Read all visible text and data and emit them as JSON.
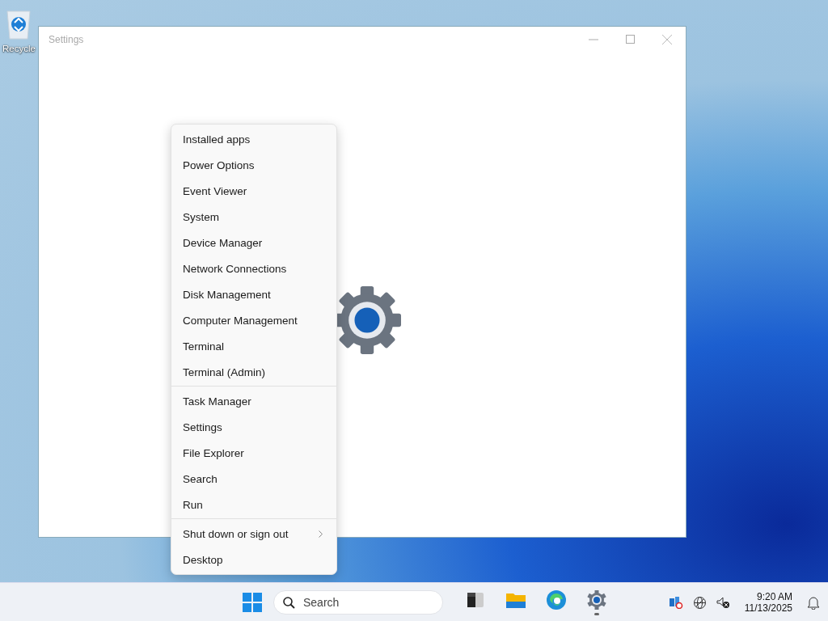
{
  "desktop": {
    "icons": [
      {
        "label": "Recycle"
      }
    ]
  },
  "window": {
    "title": "Settings"
  },
  "context_menu": {
    "groups": [
      {
        "items": [
          {
            "label": "Installed apps",
            "has_submenu": false
          },
          {
            "label": "Power Options",
            "has_submenu": false
          },
          {
            "label": "Event Viewer",
            "has_submenu": false
          },
          {
            "label": "System",
            "has_submenu": false
          },
          {
            "label": "Device Manager",
            "has_submenu": false
          },
          {
            "label": "Network Connections",
            "has_submenu": false
          },
          {
            "label": "Disk Management",
            "has_submenu": false
          },
          {
            "label": "Computer Management",
            "has_submenu": false
          },
          {
            "label": "Terminal",
            "has_submenu": false
          },
          {
            "label": "Terminal (Admin)",
            "has_submenu": false
          }
        ]
      },
      {
        "items": [
          {
            "label": "Task Manager",
            "has_submenu": false
          },
          {
            "label": "Settings",
            "has_submenu": false
          },
          {
            "label": "File Explorer",
            "has_submenu": false
          },
          {
            "label": "Search",
            "has_submenu": false
          },
          {
            "label": "Run",
            "has_submenu": false
          }
        ]
      },
      {
        "items": [
          {
            "label": "Shut down or sign out",
            "has_submenu": true
          },
          {
            "label": "Desktop",
            "has_submenu": false
          }
        ]
      }
    ]
  },
  "taskbar": {
    "search": {
      "placeholder": "Search"
    },
    "apps": [
      {
        "kind": "terminal",
        "running": false
      },
      {
        "kind": "folder",
        "running": false
      },
      {
        "kind": "browser",
        "running": false
      },
      {
        "kind": "gear",
        "running": true
      }
    ],
    "clock": {
      "time": "9:20 AM",
      "date": "11/13/2025"
    }
  }
}
